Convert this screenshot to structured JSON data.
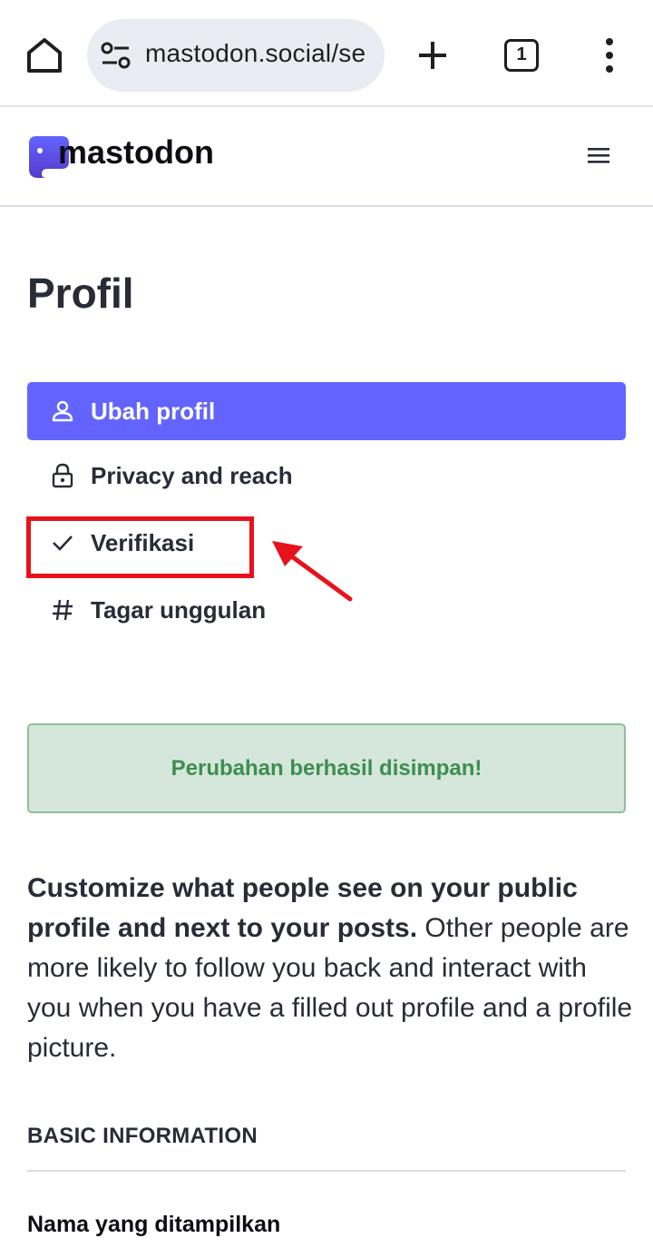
{
  "browser": {
    "url": "mastodon.social/se",
    "tab_count": "1",
    "icons": [
      "home-icon",
      "site-settings-icon",
      "plus-icon",
      "tab-switcher-icon",
      "more-vert-icon"
    ]
  },
  "site": {
    "logo_text": "mastodon",
    "menu_icon": "hamburger-icon"
  },
  "page": {
    "title": "Profil"
  },
  "nav": {
    "items": [
      {
        "label": "Ubah profil",
        "icon": "person-icon",
        "active": true
      },
      {
        "label": "Privacy and reach",
        "icon": "lock-icon",
        "active": false
      },
      {
        "label": "Verifikasi",
        "icon": "check-icon",
        "active": false
      },
      {
        "label": "Tagar unggulan",
        "icon": "hashtag-icon",
        "active": false
      }
    ]
  },
  "flash": {
    "message": "Perubahan berhasil disimpan!"
  },
  "lead": {
    "bold": "Customize what people see on your public profile and next to your posts.",
    "rest": " Other people are more likely to follow you back and interact with you when you have a filled out profile and a profile picture."
  },
  "basic_info": {
    "heading": "BASIC INFORMATION",
    "display_name_label": "Nama yang ditampilkan"
  },
  "colors": {
    "accent": "#6364ff",
    "annotation": "#e8121d",
    "success_bg": "#d4e7da",
    "success_text": "#3e8e52"
  }
}
